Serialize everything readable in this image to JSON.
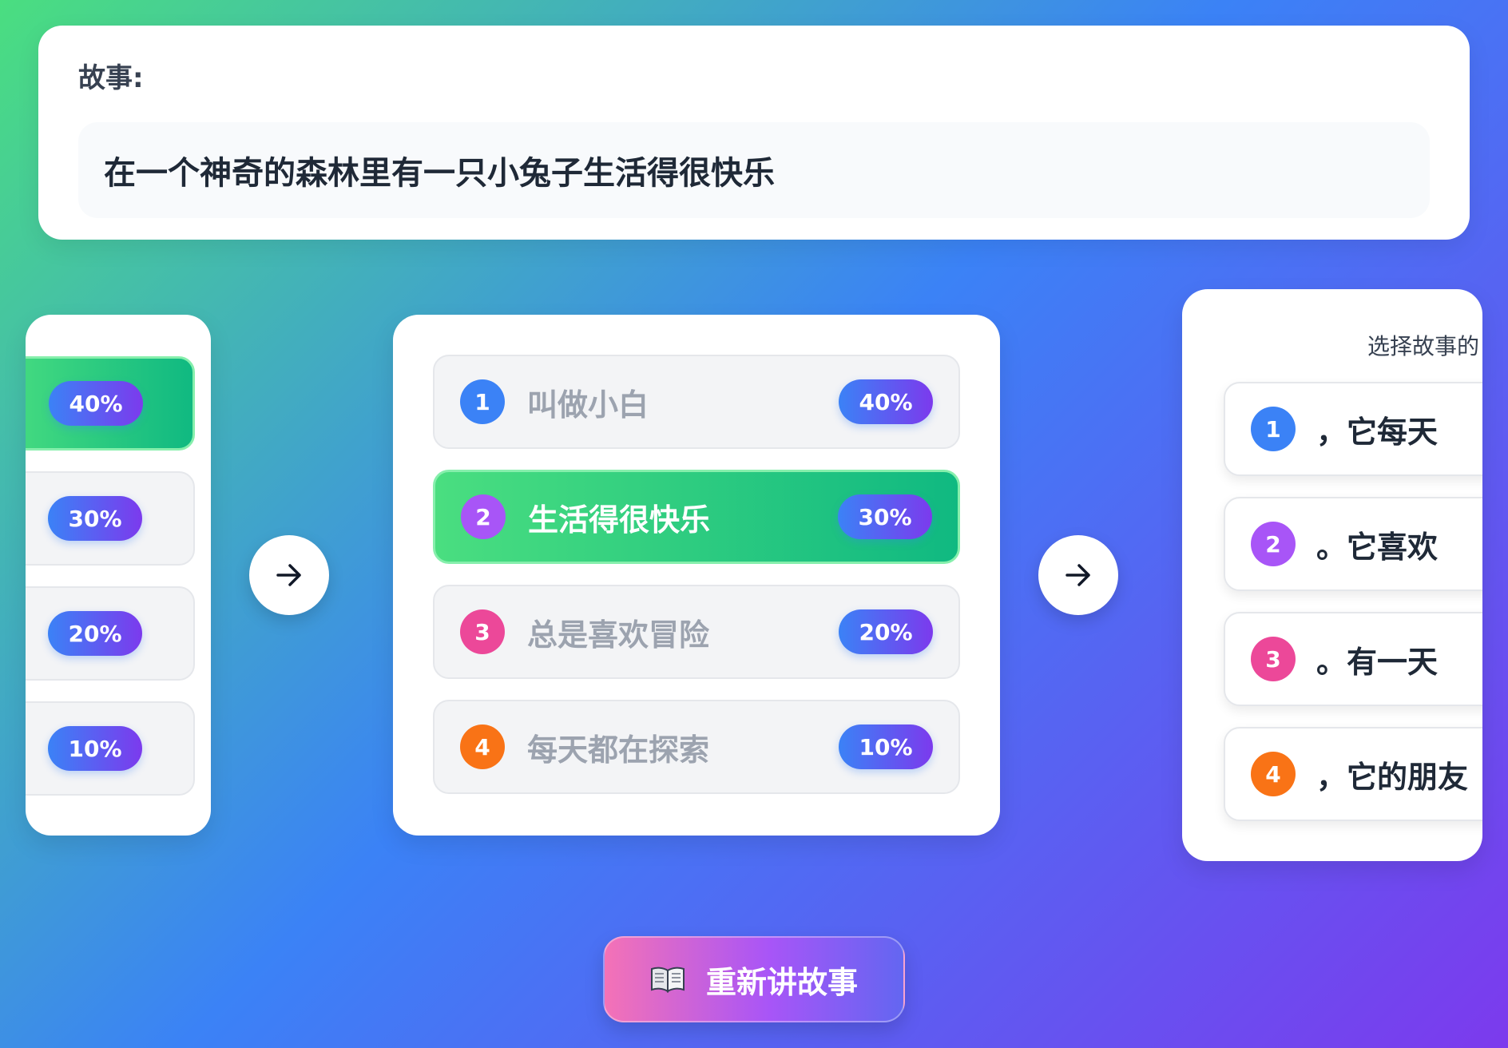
{
  "story": {
    "label": "故事:",
    "text": "在一个神奇的森林里有一只小兔子生活得很快乐"
  },
  "colors": {
    "blue": "#3b82f6",
    "purple": "#a855f7",
    "pink": "#ec4899",
    "orange": "#f97316",
    "selected_green": "#22c55e"
  },
  "left_column": {
    "percents": [
      "40%",
      "30%",
      "20%",
      "10%"
    ],
    "selected_index": 0
  },
  "center_column": {
    "options": [
      {
        "num": "1",
        "text": "叫做小白",
        "percent": "40%"
      },
      {
        "num": "2",
        "text": "生活得很快乐",
        "percent": "30%"
      },
      {
        "num": "3",
        "text": "总是喜欢冒险",
        "percent": "20%"
      },
      {
        "num": "4",
        "text": "每天都在探索",
        "percent": "10%"
      }
    ],
    "selected_index": 1
  },
  "right_column": {
    "hint": "选择故事的",
    "options": [
      {
        "num": "1",
        "text": "，它每天"
      },
      {
        "num": "2",
        "text": "。它喜欢"
      },
      {
        "num": "3",
        "text": "。有一天"
      },
      {
        "num": "4",
        "text": "，它的朋友"
      }
    ]
  },
  "retell_button": {
    "icon": "open-book-icon",
    "label": "重新讲故事"
  }
}
